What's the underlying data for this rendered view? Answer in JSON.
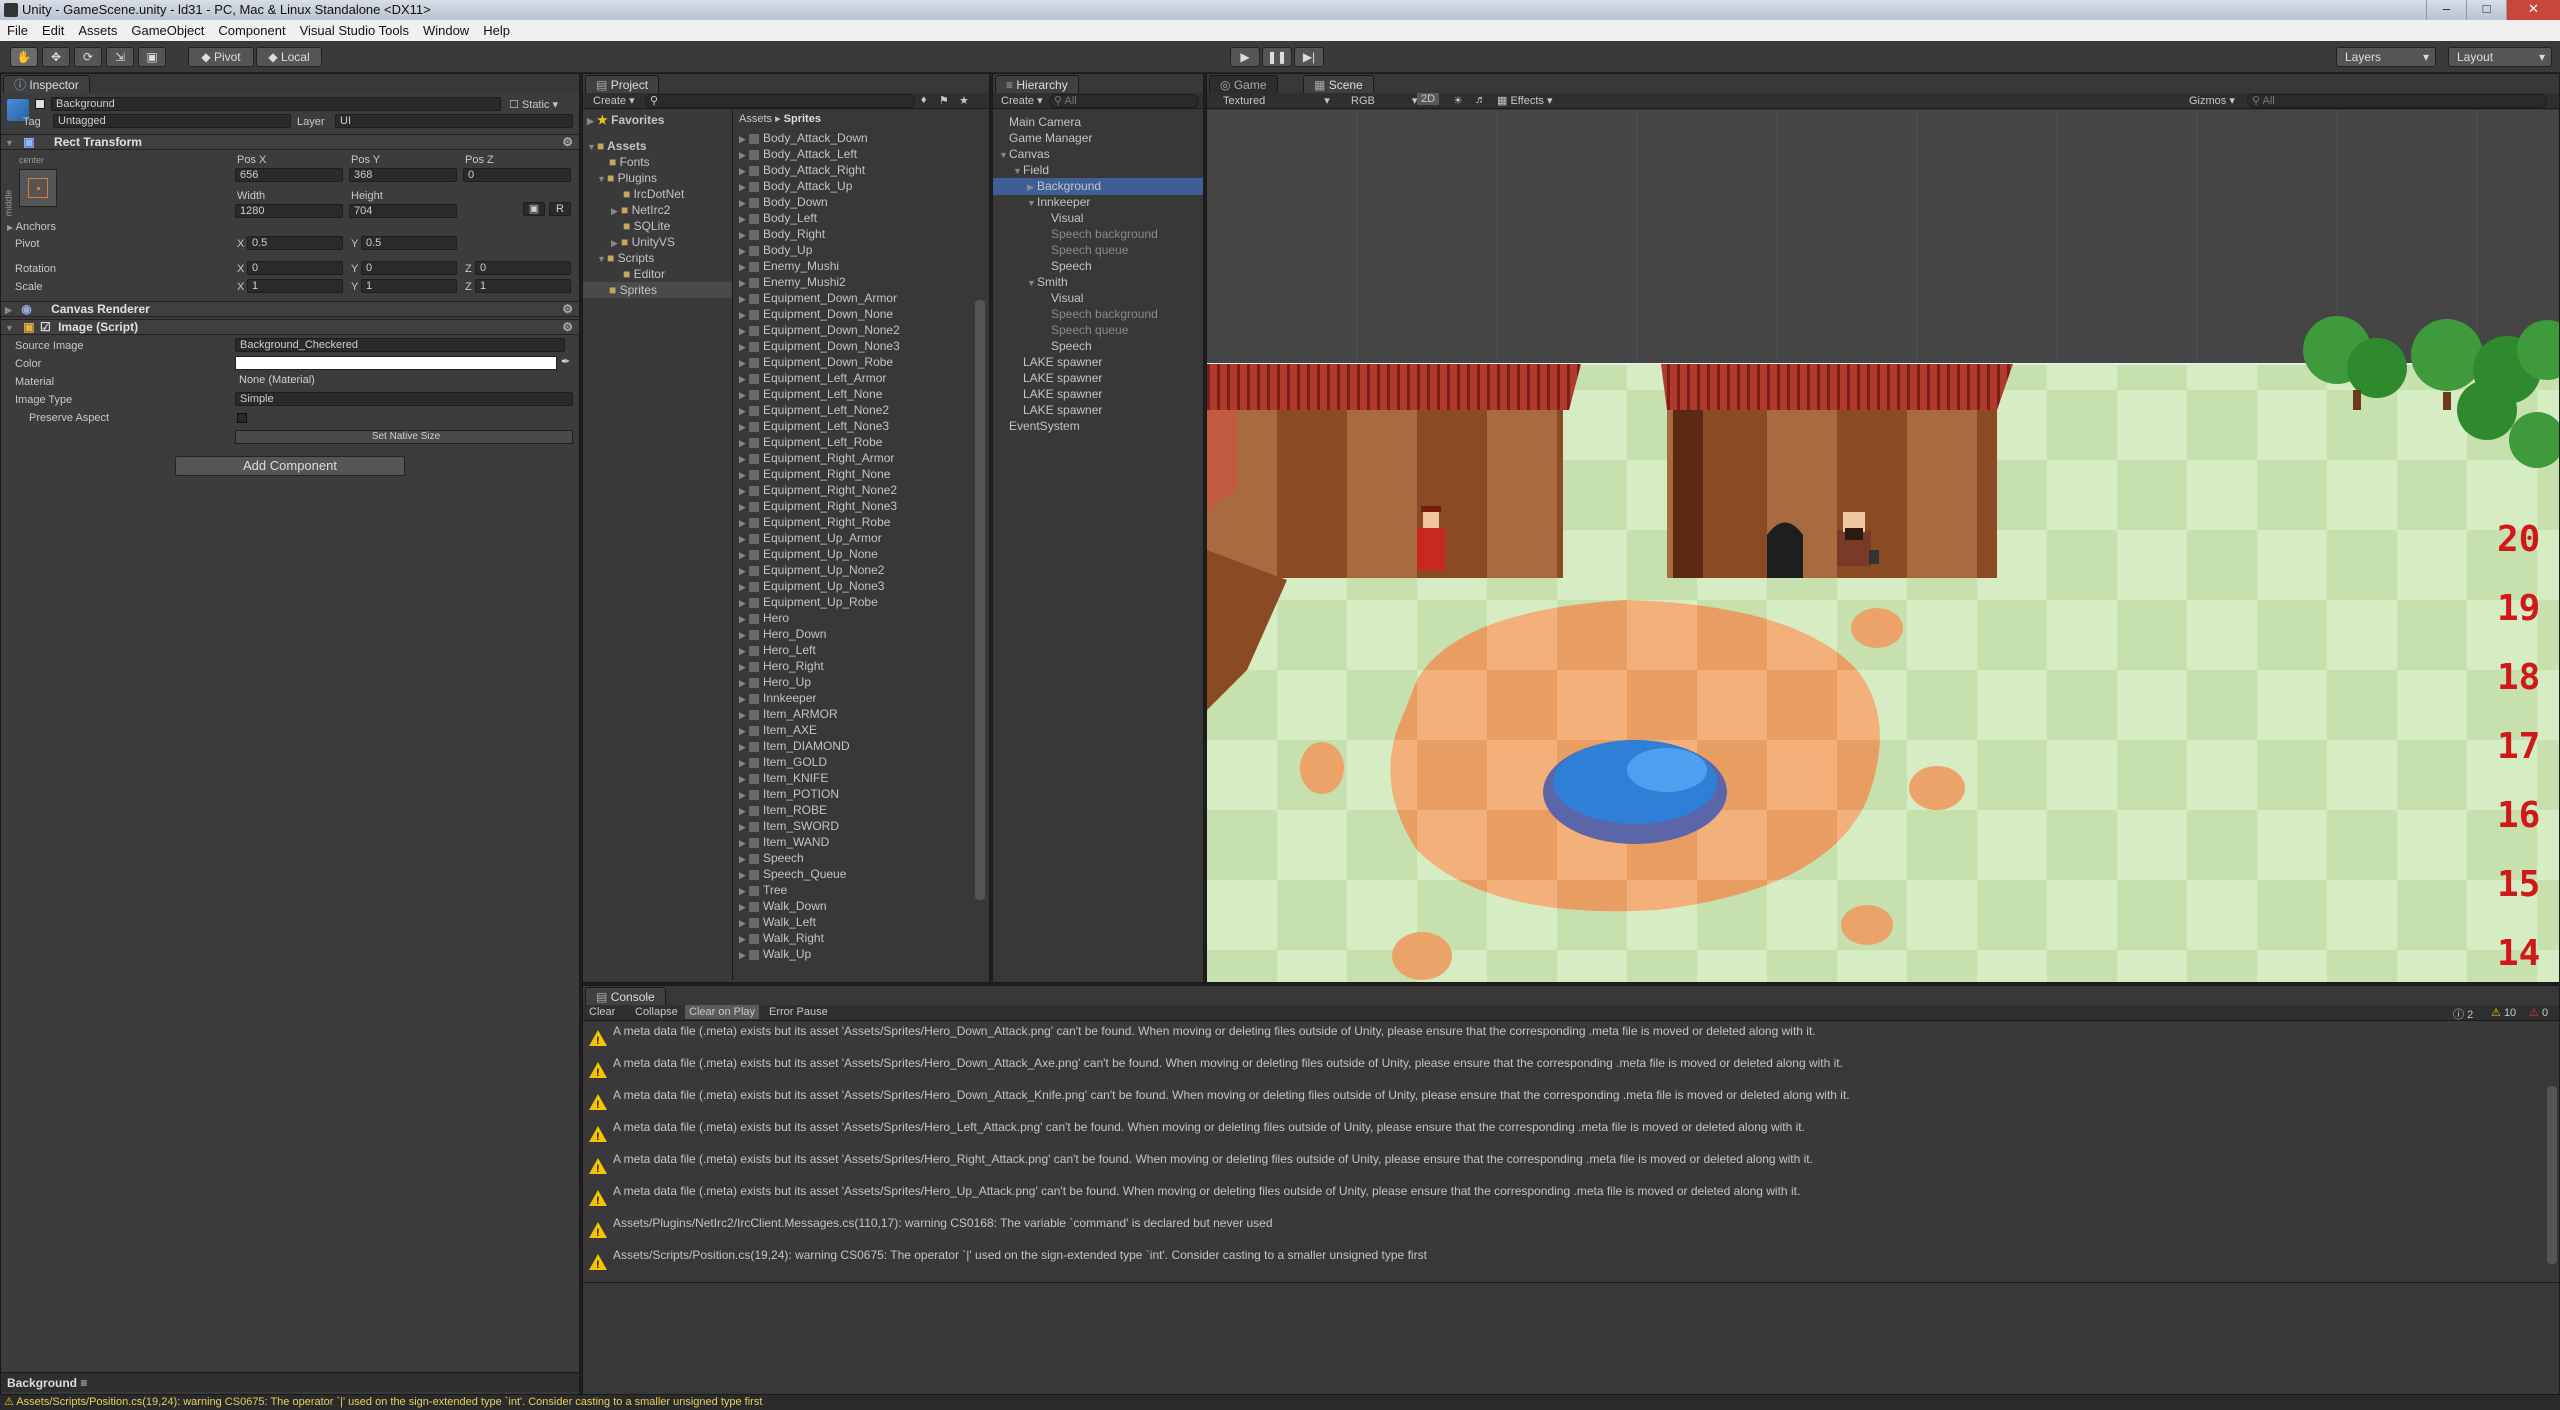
{
  "title": "Unity - GameScene.unity - ld31 - PC, Mac & Linux Standalone <DX11>",
  "menu": [
    "File",
    "Edit",
    "Assets",
    "GameObject",
    "Component",
    "Visual Studio Tools",
    "Window",
    "Help"
  ],
  "toolbar": {
    "pivot": "Pivot",
    "local": "Local",
    "layers": "Layers",
    "layout": "Layout"
  },
  "inspector": {
    "tab": "Inspector",
    "object_name": "Background",
    "static": "Static",
    "tag_label": "Tag",
    "tag": "Untagged",
    "layer_label": "Layer",
    "layer": "UI",
    "rect_transform": "Rect Transform",
    "anchor_h": "center",
    "anchor_v": "middle",
    "posx_label": "Pos X",
    "posy_label": "Pos Y",
    "posz_label": "Pos Z",
    "posx": "656",
    "posy": "368",
    "posz": "0",
    "width_label": "Width",
    "height_label": "Height",
    "width": "1280",
    "height": "704",
    "r_btn": "R",
    "anchors": "Anchors",
    "pivot_label": "Pivot",
    "pivot_x": "0.5",
    "pivot_y": "0.5",
    "rotation_label": "Rotation",
    "rot_x": "0",
    "rot_y": "0",
    "rot_z": "0",
    "scale_label": "Scale",
    "scale_x": "1",
    "scale_y": "1",
    "scale_z": "1",
    "x": "X",
    "y": "Y",
    "z": "Z",
    "canvas_renderer": "Canvas Renderer",
    "image_script": "Image (Script)",
    "source_image_label": "Source Image",
    "source_image": "Background_Checkered",
    "color_label": "Color",
    "material_label": "Material",
    "material": "None (Material)",
    "image_type_label": "Image Type",
    "image_type": "Simple",
    "preserve_aspect": "Preserve Aspect",
    "set_native_size": "Set Native Size",
    "add_component": "Add Component",
    "preview_label": "Background"
  },
  "project": {
    "tab": "Project",
    "create": "Create",
    "favorites": "Favorites",
    "assets": "Assets",
    "folders": [
      "Fonts",
      "Plugins",
      "IrcDotNet",
      "NetIrc2",
      "SQLite",
      "UnityVS",
      "Scripts",
      "Editor",
      "Sprites"
    ],
    "breadcrumb_root": "Assets",
    "breadcrumb_leaf": "Sprites",
    "sprites": [
      "Body_Attack_Down",
      "Body_Attack_Left",
      "Body_Attack_Right",
      "Body_Attack_Up",
      "Body_Down",
      "Body_Left",
      "Body_Right",
      "Body_Up",
      "Enemy_Mushi",
      "Enemy_Mushi2",
      "Equipment_Down_Armor",
      "Equipment_Down_None",
      "Equipment_Down_None2",
      "Equipment_Down_None3",
      "Equipment_Down_Robe",
      "Equipment_Left_Armor",
      "Equipment_Left_None",
      "Equipment_Left_None2",
      "Equipment_Left_None3",
      "Equipment_Left_Robe",
      "Equipment_Right_Armor",
      "Equipment_Right_None",
      "Equipment_Right_None2",
      "Equipment_Right_None3",
      "Equipment_Right_Robe",
      "Equipment_Up_Armor",
      "Equipment_Up_None",
      "Equipment_Up_None2",
      "Equipment_Up_None3",
      "Equipment_Up_Robe",
      "Hero",
      "Hero_Down",
      "Hero_Left",
      "Hero_Right",
      "Hero_Up",
      "Innkeeper",
      "Item_ARMOR",
      "Item_AXE",
      "Item_DIAMOND",
      "Item_GOLD",
      "Item_KNIFE",
      "Item_POTION",
      "Item_ROBE",
      "Item_SWORD",
      "Item_WAND",
      "Speech",
      "Speech_Queue",
      "Tree",
      "Walk_Down",
      "Walk_Left",
      "Walk_Right",
      "Walk_Up"
    ]
  },
  "hierarchy": {
    "tab": "Hierarchy",
    "create": "Create",
    "search": "All",
    "items": [
      "Main Camera",
      "Game Manager",
      "Canvas",
      "Field",
      "Background",
      "Innkeeper",
      "Visual",
      "Speech background",
      "Speech queue",
      "Speech",
      "Smith",
      "Visual",
      "Speech background",
      "Speech queue",
      "Speech",
      "LAKE spawner",
      "LAKE spawner",
      "LAKE spawner",
      "LAKE spawner",
      "EventSystem"
    ]
  },
  "scene": {
    "game_tab": "Game",
    "scene_tab": "Scene",
    "textured": "Textured",
    "rgb": "RGB",
    "mode2d": "2D",
    "effects": "Effects",
    "gizmos": "Gizmos",
    "search": "All",
    "numbers": [
      "20",
      "19",
      "18",
      "17",
      "16",
      "15",
      "14"
    ]
  },
  "console": {
    "tab": "Console",
    "buttons": [
      "Clear",
      "Collapse",
      "Clear on Play",
      "Error Pause"
    ],
    "info_count": "2",
    "warn_count": "10",
    "error_count": "0",
    "messages": [
      "A meta data file (.meta) exists but its asset 'Assets/Sprites/Hero_Down_Attack.png' can't be found. When moving or deleting files outside of Unity, please ensure that the corresponding .meta file is moved or deleted along with it.",
      "A meta data file (.meta) exists but its asset 'Assets/Sprites/Hero_Down_Attack_Axe.png' can't be found. When moving or deleting files outside of Unity, please ensure that the corresponding .meta file is moved or deleted along with it.",
      "A meta data file (.meta) exists but its asset 'Assets/Sprites/Hero_Down_Attack_Knife.png' can't be found. When moving or deleting files outside of Unity, please ensure that the corresponding .meta file is moved or deleted along with it.",
      "A meta data file (.meta) exists but its asset 'Assets/Sprites/Hero_Left_Attack.png' can't be found. When moving or deleting files outside of Unity, please ensure that the corresponding .meta file is moved or deleted along with it.",
      "A meta data file (.meta) exists but its asset 'Assets/Sprites/Hero_Right_Attack.png' can't be found. When moving or deleting files outside of Unity, please ensure that the corresponding .meta file is moved or deleted along with it.",
      "A meta data file (.meta) exists but its asset 'Assets/Sprites/Hero_Up_Attack.png' can't be found. When moving or deleting files outside of Unity, please ensure that the corresponding .meta file is moved or deleted along with it.",
      "Assets/Plugins/NetIrc2/IrcClient.Messages.cs(110,17): warning CS0168: The variable `command' is declared but never used",
      "Assets/Scripts/Position.cs(19,24): warning CS0675: The operator `|' used on the sign-extended type `int'. Consider casting to a smaller unsigned type first"
    ]
  },
  "statusbar": "Assets/Scripts/Position.cs(19,24): warning CS0675: The operator `|' used on the sign-extended type `int'. Consider casting to a smaller unsigned type first",
  "colors": {
    "warn": "#f5c400",
    "selection": "#3e5f96",
    "grass_light": "#d6ecc2",
    "grass_dark": "#c8e2b2",
    "roof": "#a8322a",
    "lake": "#2a8ae0"
  }
}
